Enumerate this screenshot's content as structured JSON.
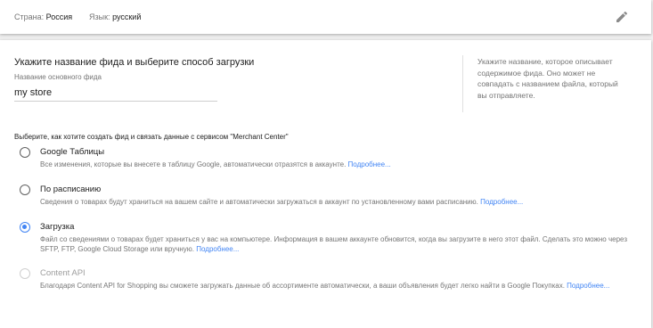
{
  "header": {
    "country_label": "Страна:",
    "country_value": "Россия",
    "language_label": "Язык:",
    "language_value": "русский",
    "edit_icon": "pencil-icon"
  },
  "feed": {
    "section_title": "Укажите название фида и выберите способ загрузки",
    "name_label": "Название основного фида",
    "name_value": "my store",
    "hint": "Укажите название, которое описывает содержимое фида. Оно может не совпадать с названием файла, который вы отправляете.",
    "choose_label": "Выберите, как хотите создать фид и связать данные с сервисом \"Merchant Center\"",
    "options": [
      {
        "title": "Google Таблицы",
        "description": "Все изменения, которые вы внесете в таблицу Google, автоматически отразятся в аккаунте.",
        "more": "Подробнее...",
        "selected": false,
        "disabled": false
      },
      {
        "title": "По расписанию",
        "description": "Сведения о товарах будут храниться на вашем сайте и автоматически загружаться в аккаунт по установленному вами расписанию.",
        "more": "Подробнее...",
        "selected": false,
        "disabled": false
      },
      {
        "title": "Загрузка",
        "description": "Файл со сведениями о товарах будет храниться у вас на компьютере. Информация в вашем аккаунте обновится, когда вы загрузите в него этот файл. Сделать это можно через SFTP, FTP, Google Cloud Storage или вручную.",
        "more": "Подробнее...",
        "selected": true,
        "disabled": false
      },
      {
        "title": "Content API",
        "description": "Благодаря Content API for Shopping вы сможете загружать данные об ассортименте автоматически, а ваши объявления будет легко найти в Google Покупках.",
        "more": "Подробнее...",
        "selected": false,
        "disabled": true
      }
    ]
  },
  "colors": {
    "accent": "#4285f4",
    "background": "#eeeeee",
    "card": "#ffffff",
    "secondary_text": "#757575"
  }
}
